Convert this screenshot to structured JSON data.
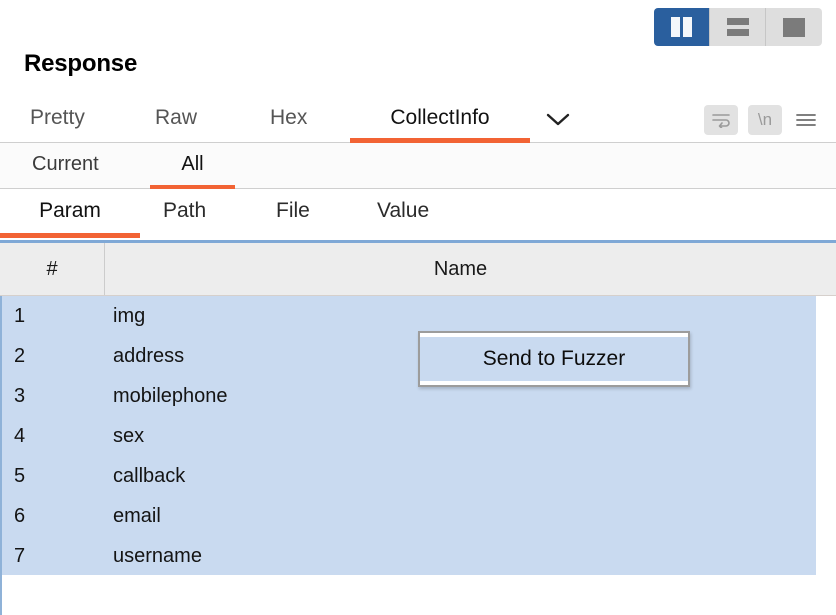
{
  "viewmode": {
    "buttons": [
      {
        "name": "split-vertical",
        "label": "Split vertical",
        "active": true
      },
      {
        "name": "split-horizontal",
        "label": "Split horizontal",
        "active": false
      },
      {
        "name": "single-pane",
        "label": "Single pane",
        "active": false
      }
    ],
    "active_color": "#2a5f9e",
    "inactive_color": "#dedede"
  },
  "panel": {
    "title": "Response",
    "accent_color": "#f26334",
    "selection_color": "#c9daf0"
  },
  "tabs_primary": [
    {
      "label": "Pretty",
      "active": false
    },
    {
      "label": "Raw",
      "active": false
    },
    {
      "label": "Hex",
      "active": false
    },
    {
      "label": "CollectInfo",
      "active": true
    }
  ],
  "tabs_primary_dropdown": {
    "icon": "chevron-down-icon"
  },
  "toolbar_icons": [
    {
      "name": "word-wrap-icon",
      "glyph": "⤵"
    },
    {
      "name": "newline-icon",
      "glyph": "\\n"
    },
    {
      "name": "hamburger-menu-icon",
      "glyph": "☰"
    }
  ],
  "tabs_secondary": [
    {
      "label": "Current",
      "active": false
    },
    {
      "label": "All",
      "active": true
    }
  ],
  "tabs_tertiary": [
    {
      "label": "Param",
      "active": true
    },
    {
      "label": "Path",
      "active": false
    },
    {
      "label": "File",
      "active": false
    },
    {
      "label": "Value",
      "active": false
    }
  ],
  "table": {
    "columns": [
      {
        "key": "num",
        "label": "#"
      },
      {
        "key": "name",
        "label": "Name"
      }
    ],
    "rows": [
      {
        "num": "1",
        "name": "img"
      },
      {
        "num": "2",
        "name": "address"
      },
      {
        "num": "3",
        "name": "mobilephone"
      },
      {
        "num": "4",
        "name": "sex"
      },
      {
        "num": "5",
        "name": "callback"
      },
      {
        "num": "6",
        "name": "email"
      },
      {
        "num": "7",
        "name": "username"
      }
    ]
  },
  "context_menu": {
    "items": [
      {
        "label": "Send to Fuzzer",
        "highlighted": true
      }
    ]
  }
}
